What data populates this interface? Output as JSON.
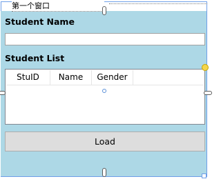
{
  "window": {
    "title": "第一个窗口"
  },
  "student_name": {
    "label": "Student Name",
    "value": "",
    "placeholder": ""
  },
  "student_list": {
    "label": "Student List",
    "columns": [
      "StuID",
      "Name",
      "Gender"
    ],
    "rows": []
  },
  "actions": {
    "load_label": "Load"
  },
  "colors": {
    "window_background": "#add8e6",
    "button_background": "#dddddd"
  }
}
